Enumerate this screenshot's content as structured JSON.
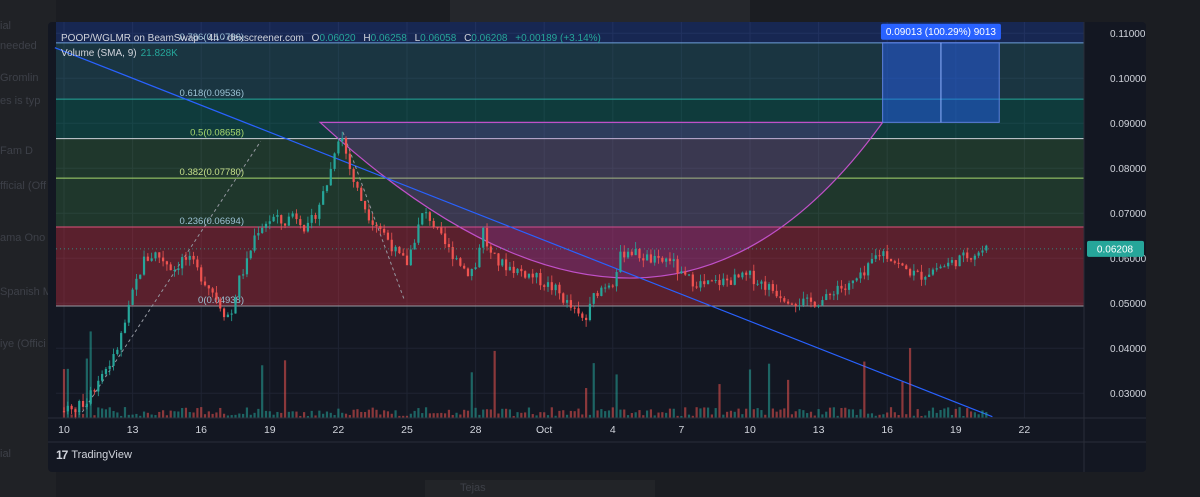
{
  "background_text": [
    "ial",
    "needed",
    "Gromlin",
    "es is typ",
    "Fam D",
    "fficial (Off",
    "ama Ono",
    "Spanish M",
    "iye (Offici",
    "ial",
    "Tejas"
  ],
  "header": {
    "pair": "POOP/WGLMR on BeamSwap",
    "interval": "4h",
    "source": "dexscreener.com",
    "o_label": "O",
    "o_value": "0.06020",
    "h_label": "H",
    "h_value": "0.06258",
    "l_label": "L",
    "l_value": "0.06058",
    "c_label": "C",
    "c_value": "0.06208",
    "change": "+0.00189 (+3.14%)"
  },
  "volume_indicator": {
    "label": "Volume (SMA, 9)",
    "value": "21.828K"
  },
  "footer": {
    "logo_glyph": "17",
    "brand": "TradingView"
  },
  "colors": {
    "up": "#26a69a",
    "down": "#ef5350",
    "trendline": "#2962ff",
    "fib_red_zone": "#f23645",
    "fib_green_zone": "#4caf50",
    "fib_blue_zone": "#2962ff",
    "cup_arc": "#c050c8",
    "price_badge": "#26a69a",
    "measure_box": "#2962ff"
  },
  "chart_data": {
    "type": "candlestick",
    "timeframe": "4h",
    "x_tick_labels": [
      "10",
      "13",
      "16",
      "19",
      "22",
      "25",
      "28",
      "Oct",
      "4",
      "7",
      "10",
      "13",
      "16",
      "19",
      "22"
    ],
    "y_tick_labels": [
      "0.11000",
      "0.10000",
      "0.09000",
      "0.08000",
      "0.07000",
      "0.06000",
      "0.05000",
      "0.04000",
      "0.03000"
    ],
    "ylim": [
      0.0245,
      0.1125
    ],
    "current_price_label": "0.06208",
    "fibonacci": [
      {
        "label": "0(0.04938)",
        "value": 0.04938
      },
      {
        "label": "0.236(0.06694)",
        "value": 0.06694
      },
      {
        "label": "0.382(0.07780)",
        "value": 0.0778
      },
      {
        "label": "0.5(0.08658)",
        "value": 0.08658
      },
      {
        "label": "0.618(0.09536)",
        "value": 0.09536
      },
      {
        "label": "0.786(0.10786)",
        "value": 0.10786
      }
    ],
    "measure_label": "0.09013 (100.29%) 9013",
    "measure_range": [
      0.0902,
      0.1079
    ],
    "cup_bottom": 0.0414,
    "close_path": [
      [
        0,
        0.026
      ],
      [
        0.6,
        0.0268
      ],
      [
        1.1,
        0.029
      ],
      [
        1.6,
        0.034
      ],
      [
        2.2,
        0.038
      ],
      [
        2.7,
        0.046
      ],
      [
        3.1,
        0.054
      ],
      [
        3.5,
        0.0595
      ],
      [
        4.0,
        0.061
      ],
      [
        4.4,
        0.0595
      ],
      [
        4.8,
        0.0575
      ],
      [
        5.2,
        0.06
      ],
      [
        5.6,
        0.059
      ],
      [
        6.0,
        0.056
      ],
      [
        6.6,
        0.052
      ],
      [
        7.0,
        0.048
      ],
      [
        7.3,
        0.047
      ],
      [
        7.6,
        0.0545
      ],
      [
        8.0,
        0.059
      ],
      [
        8.4,
        0.066
      ],
      [
        8.8,
        0.068
      ],
      [
        9.2,
        0.069
      ],
      [
        9.6,
        0.0675
      ],
      [
        10.0,
        0.07
      ],
      [
        10.3,
        0.069
      ],
      [
        10.6,
        0.066
      ],
      [
        11.0,
        0.07
      ],
      [
        11.3,
        0.074
      ],
      [
        11.6,
        0.078
      ],
      [
        11.9,
        0.086
      ],
      [
        12.1,
        0.088
      ],
      [
        12.3,
        0.084
      ],
      [
        12.6,
        0.078
      ],
      [
        13.0,
        0.073
      ],
      [
        13.4,
        0.069
      ],
      [
        13.8,
        0.067
      ],
      [
        14.2,
        0.064
      ],
      [
        14.6,
        0.0605
      ],
      [
        15.0,
        0.059
      ],
      [
        15.3,
        0.064
      ],
      [
        15.7,
        0.07
      ],
      [
        16.0,
        0.069
      ],
      [
        16.4,
        0.065
      ],
      [
        16.8,
        0.062
      ],
      [
        17.2,
        0.06
      ],
      [
        17.6,
        0.057
      ],
      [
        18.0,
        0.058
      ],
      [
        18.3,
        0.067
      ],
      [
        18.6,
        0.061
      ],
      [
        19.0,
        0.059
      ],
      [
        19.5,
        0.058
      ],
      [
        20.0,
        0.057
      ],
      [
        20.5,
        0.056
      ],
      [
        21.0,
        0.0545
      ],
      [
        21.5,
        0.053
      ],
      [
        22.0,
        0.05
      ],
      [
        22.5,
        0.047
      ],
      [
        22.8,
        0.046
      ],
      [
        23.2,
        0.052
      ],
      [
        23.6,
        0.054
      ],
      [
        24.0,
        0.055
      ],
      [
        24.3,
        0.06
      ],
      [
        24.6,
        0.062
      ],
      [
        25.0,
        0.061
      ],
      [
        25.5,
        0.06
      ],
      [
        26.0,
        0.059
      ],
      [
        26.5,
        0.06
      ],
      [
        27.0,
        0.056
      ],
      [
        27.5,
        0.055
      ],
      [
        28.0,
        0.054
      ],
      [
        28.5,
        0.0545
      ],
      [
        29.0,
        0.055
      ],
      [
        29.5,
        0.0555
      ],
      [
        30.0,
        0.056
      ],
      [
        30.5,
        0.0545
      ],
      [
        31.0,
        0.053
      ],
      [
        31.5,
        0.0515
      ],
      [
        32.0,
        0.0505
      ],
      [
        32.5,
        0.05
      ],
      [
        33.0,
        0.0505
      ],
      [
        33.4,
        0.051
      ],
      [
        33.8,
        0.054
      ],
      [
        34.2,
        0.053
      ],
      [
        34.6,
        0.055
      ],
      [
        35.0,
        0.056
      ],
      [
        35.4,
        0.06
      ],
      [
        35.8,
        0.0615
      ],
      [
        36.2,
        0.06
      ],
      [
        36.6,
        0.058
      ],
      [
        37.0,
        0.057
      ],
      [
        37.4,
        0.056
      ],
      [
        37.8,
        0.057
      ],
      [
        38.2,
        0.058
      ],
      [
        38.6,
        0.0585
      ],
      [
        39.0,
        0.0595
      ],
      [
        39.5,
        0.0605
      ],
      [
        40.0,
        0.0615
      ],
      [
        40.4,
        0.0621
      ]
    ]
  }
}
